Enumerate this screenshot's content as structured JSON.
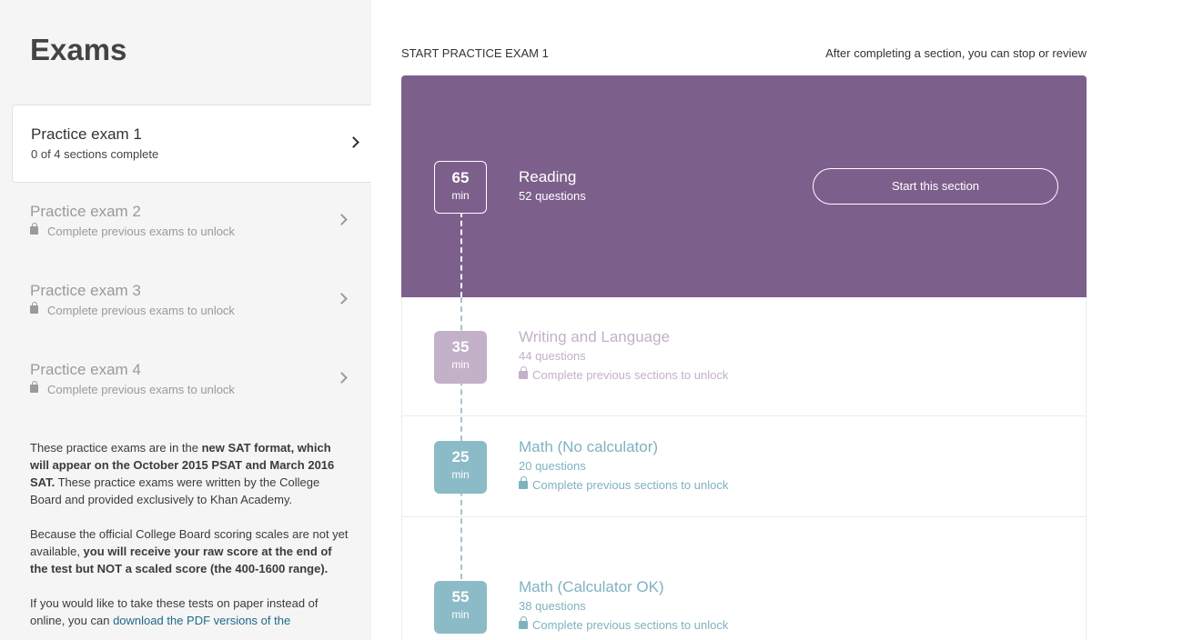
{
  "sidebar": {
    "title": "Exams",
    "exams": [
      {
        "name": "Practice exam 1",
        "status": "0 of 4 sections complete"
      },
      {
        "name": "Practice exam 2",
        "status": "Complete previous exams to unlock"
      },
      {
        "name": "Practice exam 3",
        "status": "Complete previous exams to unlock"
      },
      {
        "name": "Practice exam 4",
        "status": "Complete previous exams to unlock"
      }
    ],
    "info": {
      "p1_a": "These practice exams are in the ",
      "p1_b": "new SAT format, which will appear on the October 2015 PSAT and March 2016 SAT.",
      "p1_c": " These practice exams were written by the College Board and provided exclusively to Khan Academy.",
      "p2_a": "Because the official College Board scoring scales are not yet available, ",
      "p2_b": "you will receive your raw score at the end of the test but NOT a scaled score (the 400-1600 range).",
      "p3_a": "If you would like to take these tests on paper instead of online, you can ",
      "p3_link": "download the PDF versions of the"
    }
  },
  "main": {
    "header_left": "START PRACTICE EXAM 1",
    "header_right": "After completing a section, you can stop or review",
    "start_button": "Start this section",
    "sections": [
      {
        "minutes": "65",
        "unit": "min",
        "name": "Reading",
        "questions": "52 questions"
      },
      {
        "minutes": "35",
        "unit": "min",
        "name": "Writing and Language",
        "questions": "44 questions",
        "lock": "Complete previous sections to unlock"
      },
      {
        "minutes": "25",
        "unit": "min",
        "name": "Math (No calculator)",
        "questions": "20 questions",
        "lock": "Complete previous sections to unlock"
      },
      {
        "minutes": "55",
        "unit": "min",
        "name": "Math (Calculator OK)",
        "questions": "38 questions",
        "lock": "Complete previous sections to unlock"
      }
    ]
  },
  "colors": {
    "active_section": "#7d5f8c",
    "locked_purple": "#c3b0c9",
    "locked_teal": "#8bbbc6"
  }
}
